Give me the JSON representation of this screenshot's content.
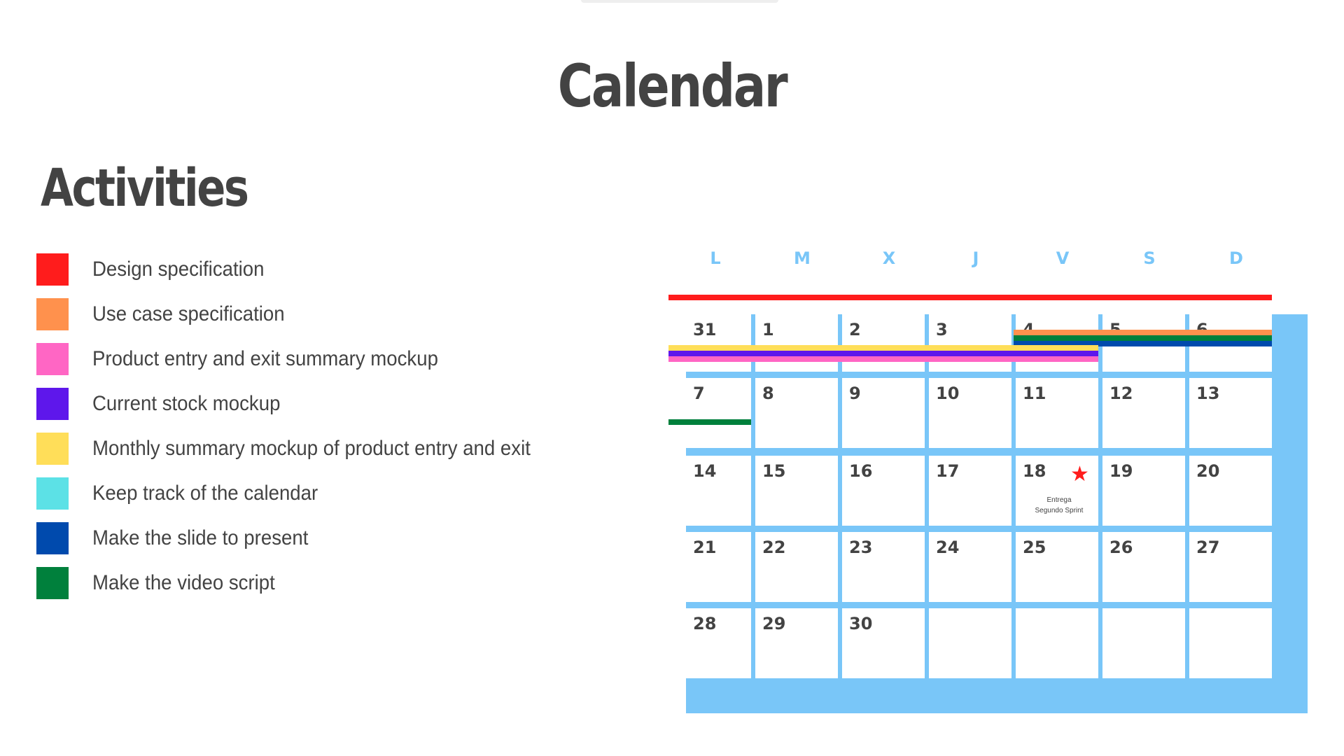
{
  "title": "Calendar",
  "activities": {
    "title": "Activities",
    "items": [
      {
        "label": "Design specification",
        "color": "#ff1c1c"
      },
      {
        "label": "Use case specification",
        "color": "#ff914d"
      },
      {
        "label": "Product entry and exit summary mockup",
        "color": "#ff66c4"
      },
      {
        "label": "Current stock mockup",
        "color": "#5e17eb"
      },
      {
        "label": "Monthly summary mockup of product entry and exit",
        "color": "#ffde59"
      },
      {
        "label": "Keep track of the calendar",
        "color": "#5ce1e6"
      },
      {
        "label": "Make the slide to present",
        "color": "#004aad"
      },
      {
        "label": "Make the video script",
        "color": "#00803c"
      }
    ]
  },
  "calendar": {
    "accent_color": "#79c6f8",
    "day_headers": [
      "L",
      "M",
      "X",
      "J",
      "V",
      "S",
      "D"
    ],
    "weeks": [
      [
        "31",
        "1",
        "2",
        "3",
        "4",
        "5",
        "6"
      ],
      [
        "7",
        "8",
        "9",
        "10",
        "11",
        "12",
        "13"
      ],
      [
        "14",
        "15",
        "16",
        "17",
        "18",
        "19",
        "20"
      ],
      [
        "21",
        "22",
        "23",
        "24",
        "25",
        "26",
        "27"
      ],
      [
        "28",
        "29",
        "30",
        "",
        "",
        "",
        ""
      ]
    ],
    "bars": [
      {
        "activity": "Design specification",
        "color": "#ff1c1c",
        "start": "31",
        "end": "6"
      },
      {
        "activity": "Use case specification",
        "color": "#ff914d",
        "start": "11",
        "end": "13"
      },
      {
        "activity": "Make the video script",
        "color": "#00803c",
        "start": "11",
        "end": "13"
      },
      {
        "activity": "Make the slide to present",
        "color": "#004aad",
        "start": "11",
        "end": "13"
      },
      {
        "activity": "Monthly summary mockup of product entry and exit",
        "color": "#ffde59",
        "start": "7",
        "end": "11"
      },
      {
        "activity": "Current stock mockup",
        "color": "#5e17eb",
        "start": "7",
        "end": "11"
      },
      {
        "activity": "Product entry and exit summary mockup",
        "color": "#ff66c4",
        "start": "7",
        "end": "11"
      },
      {
        "activity": "Make the video script",
        "color": "#00803c",
        "start": "14",
        "end": "14"
      }
    ],
    "event": {
      "day": "18",
      "icon": "star-icon",
      "star_color": "#ff1c1c",
      "note_line1": "Entrega",
      "note_line2": "Segundo Sprint"
    }
  }
}
